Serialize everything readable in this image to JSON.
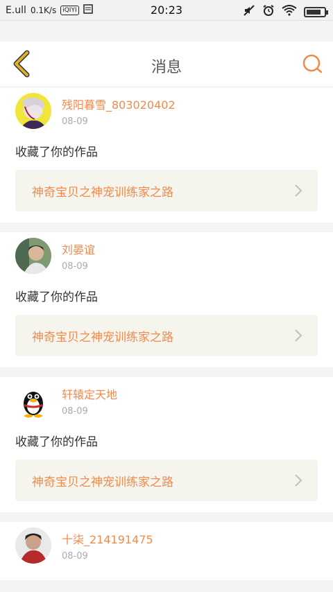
{
  "status_bar": {
    "carrier": "E.ull",
    "speed": "0.1K/s",
    "app_badge": "iQIYI",
    "time": "20:23",
    "battery_level": 0.85
  },
  "header": {
    "title": "消息"
  },
  "messages": [
    {
      "username": "残阳暮雪_803020402",
      "date": "08-09",
      "action": "收藏了你的作品",
      "work_title": "神奇宝贝之神宠训练家之路"
    },
    {
      "username": "刘晏谊",
      "date": "08-09",
      "action": "收藏了你的作品",
      "work_title": "神奇宝贝之神宠训练家之路"
    },
    {
      "username": "轩辕定天地",
      "date": "08-09",
      "action": "收藏了你的作品",
      "work_title": "神奇宝贝之神宠训练家之路"
    },
    {
      "username": "十柒_214191475",
      "date": "08-09",
      "action": "",
      "work_title": ""
    }
  ],
  "colors": {
    "accent": "#f08a4b",
    "back_arrow": "#e0b030"
  }
}
